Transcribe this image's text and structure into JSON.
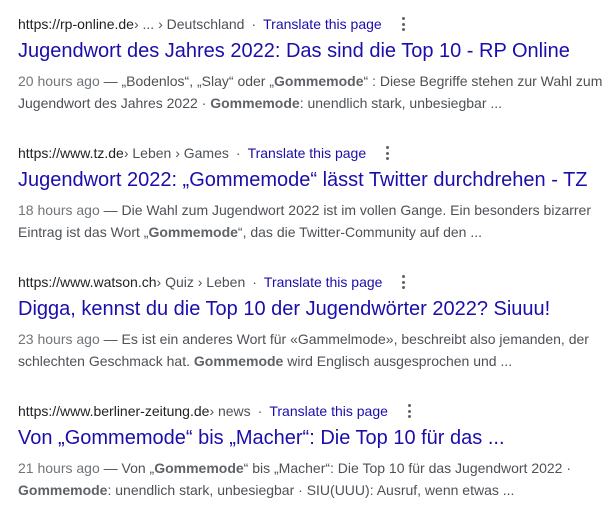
{
  "results": [
    {
      "host": "https://rp-online.de",
      "path": " › ... › Deutschland",
      "translate": "Translate this page",
      "title": "Jugendwort des Jahres 2022: Das sind die Top 10 - RP Online",
      "date": "20 hours ago",
      "snippet_parts": [
        {
          "t": " — „Bodenlos“, „Slay“ oder „",
          "b": false
        },
        {
          "t": "Gommemode",
          "b": true
        },
        {
          "t": "“ : Diese Begriffe stehen zur Wahl zum Jugendwort des Jahres 2022 · ",
          "b": false
        },
        {
          "t": "Gommemode",
          "b": true
        },
        {
          "t": ": unendlich stark, unbesiegbar ...",
          "b": false
        }
      ]
    },
    {
      "host": "https://www.tz.de",
      "path": " › Leben › Games",
      "translate": "Translate this page",
      "title": "Jugendwort 2022: „Gommemode“ lässt Twitter durchdrehen - TZ",
      "date": "18 hours ago",
      "snippet_parts": [
        {
          "t": " — Die Wahl zum Jugendwort 2022 ist im vollen Gange. Ein besonders bizarrer Eintrag ist das Wort „",
          "b": false
        },
        {
          "t": "Gommemode",
          "b": true
        },
        {
          "t": "“, das die Twitter-Community auf den ...",
          "b": false
        }
      ]
    },
    {
      "host": "https://www.watson.ch",
      "path": " › Quiz › Leben",
      "translate": "Translate this page",
      "title": "Digga, kennst du die Top 10 der Jugendwörter 2022? Siuuu!",
      "date": "23 hours ago",
      "snippet_parts": [
        {
          "t": " — Es ist ein anderes Wort für «Gammelmode», beschreibt also jemanden, der schlechten Geschmack hat. ",
          "b": false
        },
        {
          "t": "Gommemode",
          "b": true
        },
        {
          "t": " wird Englisch ausgesprochen und ...",
          "b": false
        }
      ]
    },
    {
      "host": "https://www.berliner-zeitung.de",
      "path": " › news",
      "translate": "Translate this page",
      "title": "Von „Gommemode“ bis „Macher“: Die Top 10 für das ...",
      "date": "21 hours ago",
      "snippet_parts": [
        {
          "t": " — Von „",
          "b": false
        },
        {
          "t": "Gommemode",
          "b": true
        },
        {
          "t": "“ bis „Macher“: Die Top 10 für das Jugendwort 2022 · ",
          "b": false
        },
        {
          "t": "Gommemode",
          "b": true
        },
        {
          "t": ": unendlich stark, unbesiegbar · SIU(UUU): Ausruf, wenn etwas ...",
          "b": false
        }
      ]
    }
  ]
}
